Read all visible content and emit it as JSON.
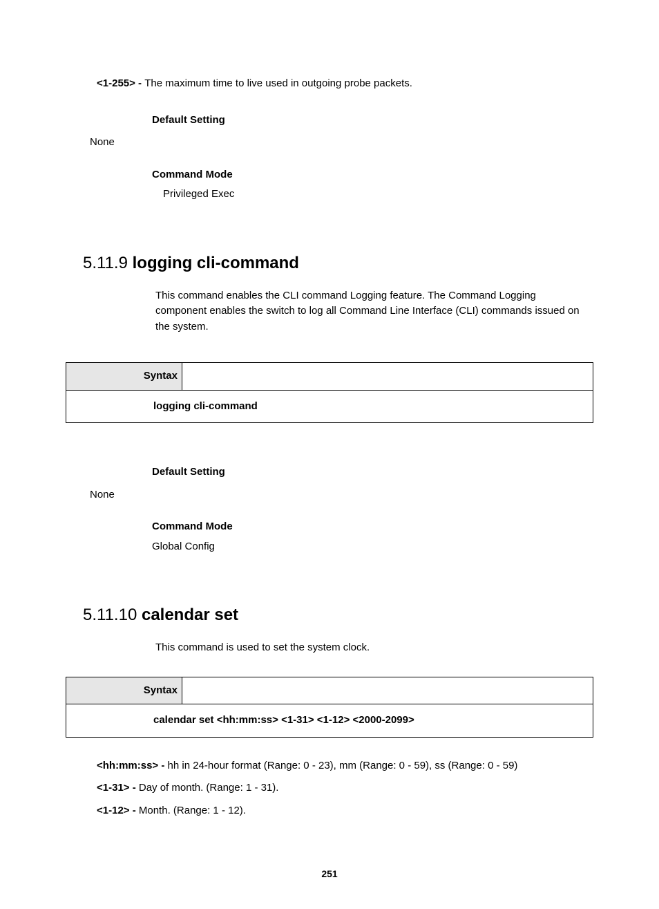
{
  "top": {
    "param_key": "<1-255> - ",
    "param_text": "The maximum time to live used in outgoing probe packets.",
    "default_setting_label": "Default Setting",
    "default_setting_value": "None",
    "command_mode_label": "Command Mode",
    "command_mode_value": "Privileged Exec"
  },
  "s1": {
    "num": "5.11.9",
    "title": "logging cli-command",
    "desc": "This command enables the CLI command Logging feature. The Command Logging component enables the switch to log all Command Line Interface (CLI) commands issued on the system.",
    "syntax_label": "Syntax",
    "syntax_body": "logging cli-command",
    "default_setting_label": "Default Setting",
    "default_setting_value": "None",
    "command_mode_label": "Command Mode",
    "command_mode_value": "Global Config"
  },
  "s2": {
    "num": "5.11.10",
    "title": "calendar set",
    "desc": "This command is used to set the system clock.",
    "syntax_label": "Syntax",
    "syntax_body": "calendar set <hh:mm:ss> <1-31> <1-12> <2000-2099>",
    "params": [
      {
        "key": "<hh:mm:ss> - ",
        "text": "hh in 24-hour format (Range: 0 - 23), mm (Range: 0 - 59), ss (Range: 0 - 59)"
      },
      {
        "key": "<1-31> - ",
        "text": "Day of month. (Range: 1 - 31)."
      },
      {
        "key": "<1-12> - ",
        "text": "Month. (Range: 1 - 12)."
      }
    ]
  },
  "page_number": "251"
}
